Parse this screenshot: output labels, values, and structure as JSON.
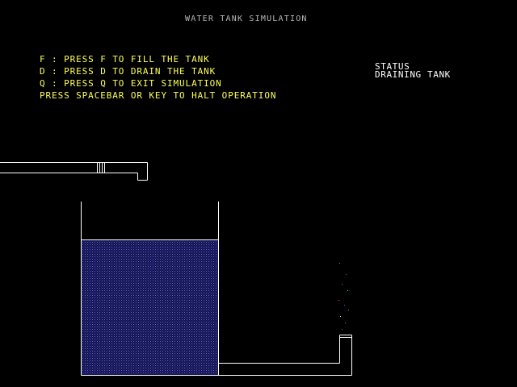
{
  "window": {
    "title": "WATER TANK SIMULATION"
  },
  "instructions": [
    "F : PRESS F TO FILL THE TANK",
    "D : PRESS D TO DRAIN THE TANK",
    "Q : PRESS Q TO EXIT SIMULATION",
    "PRESS SPACEBAR OR KEY TO HALT OPERATION"
  ],
  "status": {
    "heading": "STATUS",
    "value": "DRAINING TANK"
  },
  "tank": {
    "fill_level": 0.78,
    "water_color": "#1e1e6e",
    "outline_color": "#ffffff"
  },
  "colors": {
    "background": "#000000",
    "instruction_text": "#ffff55",
    "title_text": "#b8b8b8",
    "status_text": "#ffffff",
    "drip_colors": [
      "#ff5555",
      "#5555ff",
      "#55ff55",
      "#ffff55"
    ]
  }
}
